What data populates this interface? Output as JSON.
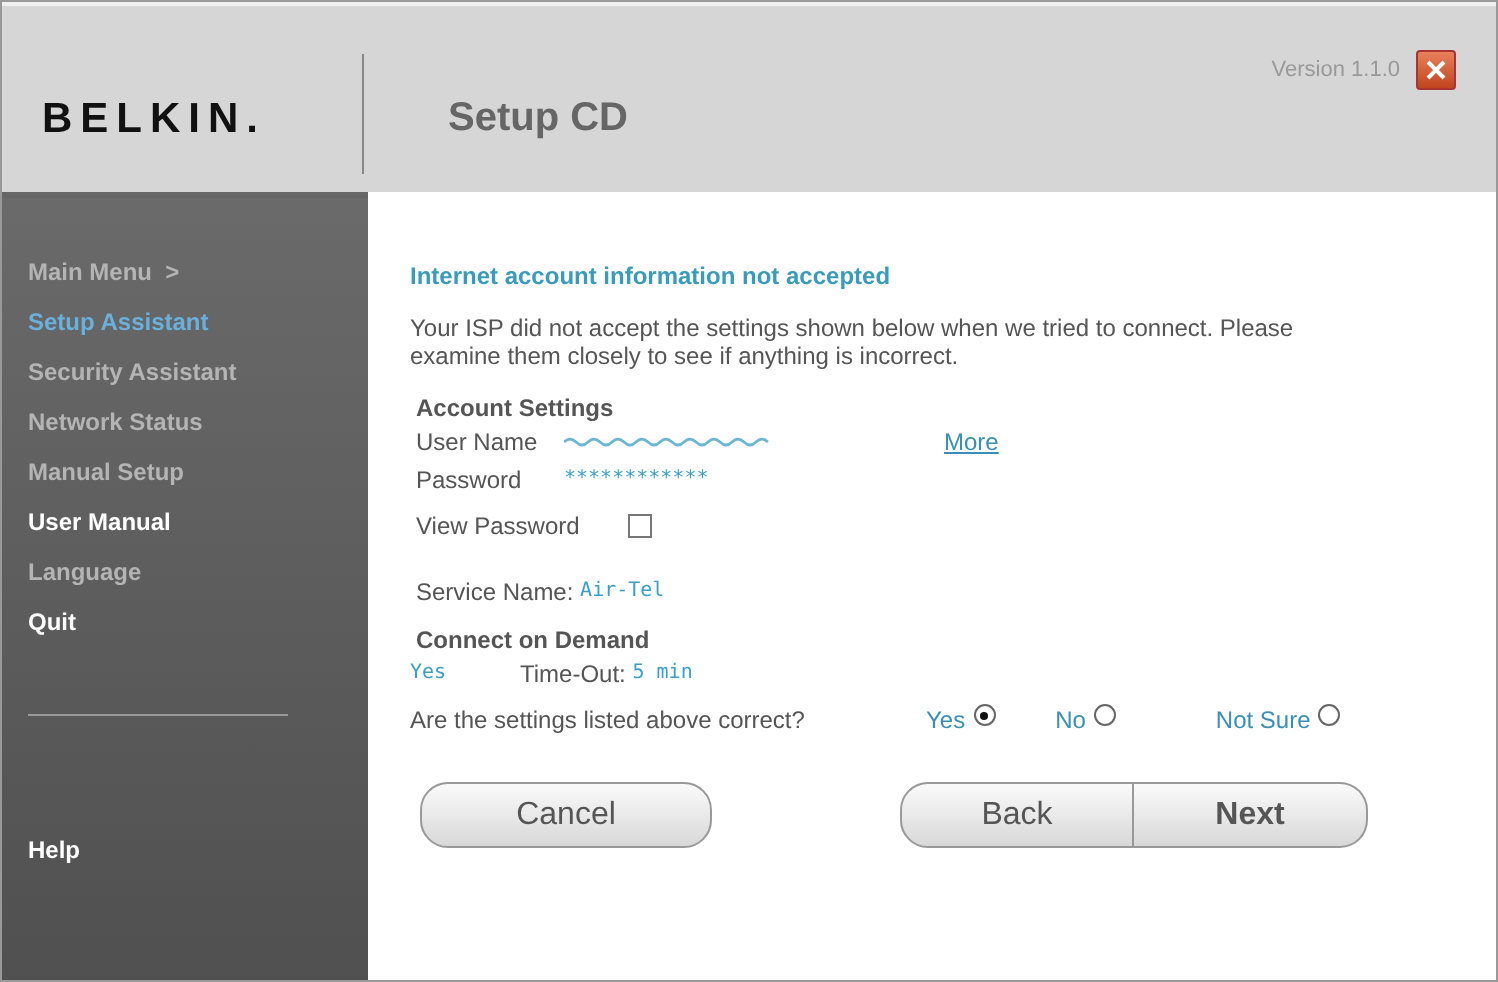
{
  "header": {
    "logo": "BELKIN.",
    "title": "Setup CD",
    "version": "Version 1.1.0"
  },
  "sidebar": {
    "items": [
      {
        "label": "Main Menu  >",
        "selected": false,
        "disabled": true
      },
      {
        "label": "Setup Assistant",
        "selected": true,
        "disabled": false
      },
      {
        "label": "Security Assistant",
        "selected": false,
        "disabled": true
      },
      {
        "label": "Network Status",
        "selected": false,
        "disabled": true
      },
      {
        "label": "Manual Setup",
        "selected": false,
        "disabled": true
      },
      {
        "label": "User Manual",
        "selected": false,
        "disabled": false
      },
      {
        "label": "Language",
        "selected": false,
        "disabled": true
      },
      {
        "label": "Quit",
        "selected": false,
        "disabled": false
      }
    ],
    "help": "Help"
  },
  "content": {
    "heading": "Internet account information not accepted",
    "message": "Your ISP did not accept the settings shown below when we tried to connect. Please examine them closely to see if anything is incorrect.",
    "account": {
      "title": "Account Settings",
      "user_name_label": "User Name",
      "more_link": "More",
      "password_label": "Password",
      "password_value": "************",
      "view_password_label": "View Password",
      "view_password_checked": false
    },
    "service": {
      "label": "Service Name:",
      "value": "Air-Tel"
    },
    "demand": {
      "title": "Connect on Demand",
      "value": "Yes",
      "timeout_label": "Time-Out:",
      "timeout_value": "5 min"
    },
    "question": "Are the settings listed above correct?",
    "answers": [
      {
        "label": "Yes",
        "selected": true
      },
      {
        "label": "No",
        "selected": false
      },
      {
        "label": "Not Sure",
        "selected": false
      }
    ]
  },
  "buttons": {
    "cancel": "Cancel",
    "back": "Back",
    "next": "Next"
  }
}
